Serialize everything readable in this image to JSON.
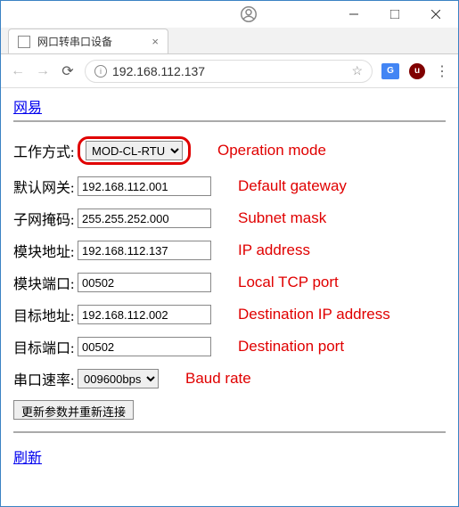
{
  "window": {
    "tab_title": "网口转串口设备",
    "url": "192.168.112.137"
  },
  "page": {
    "top_link": "网易",
    "refresh_link": "刷新",
    "submit_label": "更新参数并重新连接"
  },
  "form": {
    "mode": {
      "label": "工作方式:",
      "value": "MOD-CL-RTU",
      "annot": "Operation mode"
    },
    "gateway": {
      "label": "默认网关:",
      "value": "192.168.112.001",
      "annot": "Default gateway"
    },
    "mask": {
      "label": "子网掩码:",
      "value": "255.255.252.000",
      "annot": "Subnet mask"
    },
    "ip": {
      "label": "模块地址:",
      "value": "192.168.112.137",
      "annot": "IP address"
    },
    "lport": {
      "label": "模块端口:",
      "value": "00502",
      "annot": "Local TCP port"
    },
    "dip": {
      "label": "目标地址:",
      "value": "192.168.112.002",
      "annot": "Destination IP address"
    },
    "dport": {
      "label": "目标端口:",
      "value": "00502",
      "annot": "Destination port"
    },
    "baud": {
      "label": "串口速率:",
      "value": "009600bps",
      "annot": "Baud rate"
    }
  }
}
